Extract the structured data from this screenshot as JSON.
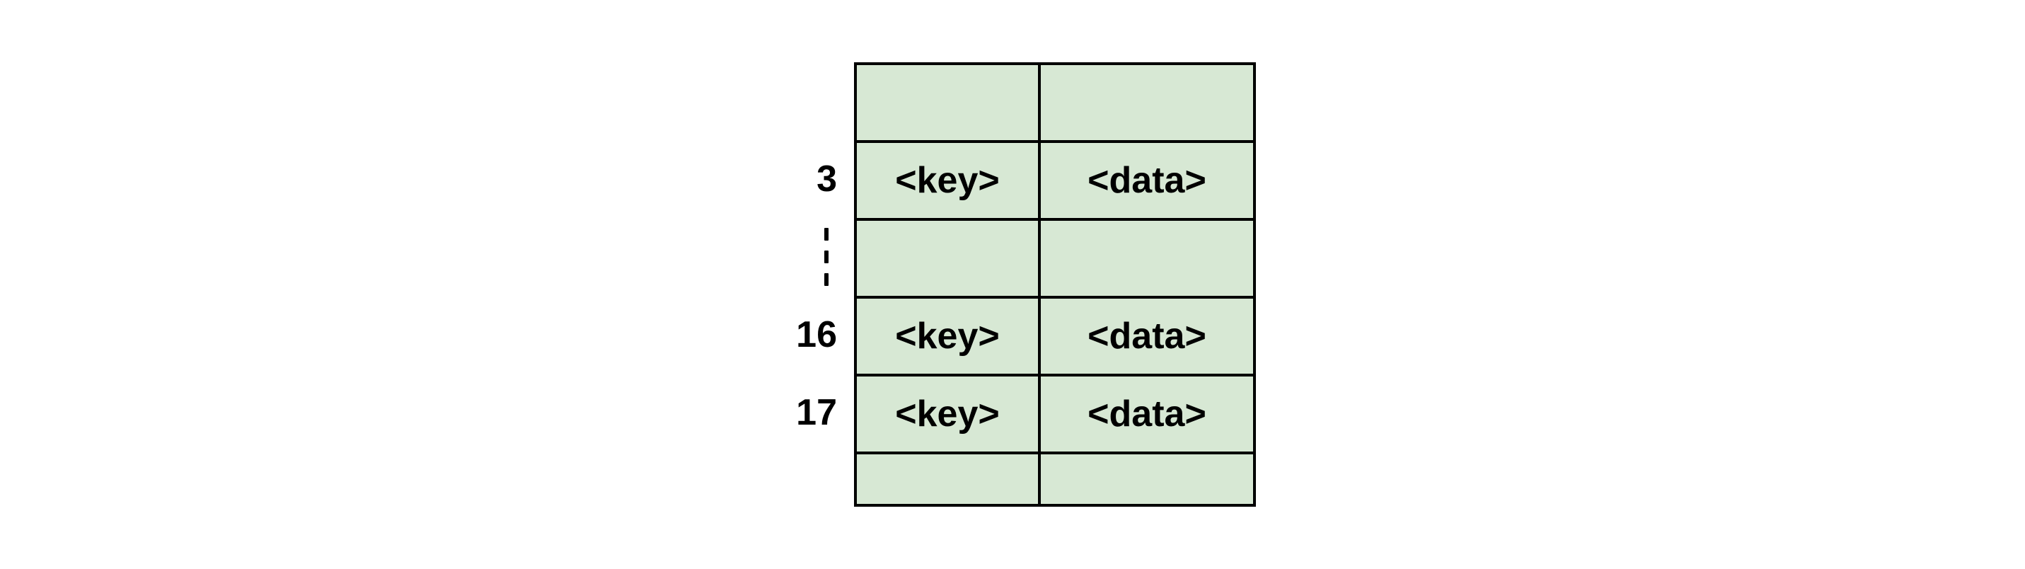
{
  "colors": {
    "cell_bg": "#d7e8d4",
    "border": "#000000"
  },
  "rows": [
    {
      "index": "",
      "key": "",
      "data": "",
      "short": false
    },
    {
      "index": "3",
      "key": "<key>",
      "data": "<data>",
      "short": false
    },
    {
      "index": "",
      "key": "",
      "data": "",
      "short": false,
      "dashes_after": true
    },
    {
      "index": "16",
      "key": "<key>",
      "data": "<data>",
      "short": false
    },
    {
      "index": "17",
      "key": "<key>",
      "data": "<data>",
      "short": false
    },
    {
      "index": "",
      "key": "",
      "data": "",
      "short": true
    }
  ]
}
